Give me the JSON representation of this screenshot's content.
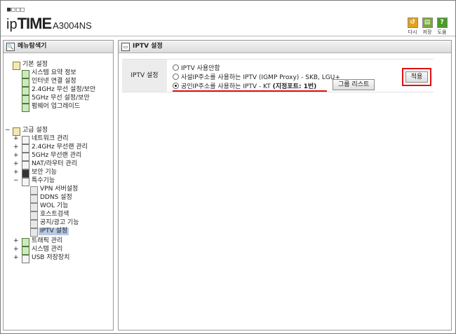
{
  "header": {
    "logo_dots": "■□□□",
    "brand_ip": "ip",
    "brand_time": "TIME",
    "model": "A3004NS",
    "buttons": [
      {
        "label": "다시",
        "icon": "refresh-icon",
        "color": "#e3a21a"
      },
      {
        "label": "저장",
        "icon": "save-icon",
        "color": "#7aa83a"
      },
      {
        "label": "도움",
        "icon": "help-icon",
        "color": "#4a9a2a"
      }
    ]
  },
  "sidebar": {
    "title": "메뉴탐색기",
    "basic": {
      "label": "기본 설정",
      "items": [
        "시스템 요약 정보",
        "인터넷 연결 설정",
        "2.4GHz 무선 설정/보안",
        "5GHz 무선 설정/보안",
        "펌웨어 업그레이드"
      ]
    },
    "advanced": {
      "label": "고급 설정",
      "items": [
        "네트워크 관리",
        "2.4GHz 무선랜 관리",
        "5GHz 무선랜 관리",
        "NAT/라우터 관리",
        "보안 기능",
        "특수기능"
      ],
      "special_items": [
        "VPN 서버설정",
        "DDNS 설정",
        "WOL 기능",
        "호스트검색",
        "공지/광고 기능",
        "IPTV 설정"
      ],
      "tail_items": [
        "트래픽 관리",
        "시스템 관리",
        "USB 저장장치"
      ]
    }
  },
  "main": {
    "title": "IPTV 설정",
    "row_label": "IPTV 설정",
    "options": [
      {
        "label": "IPTV 사용안함",
        "selected": false
      },
      {
        "label": "사설IP주소를 사용하는 IPTV (IGMP Proxy) - SKB, LGU+",
        "selected": false
      },
      {
        "label": "공인IP주소를 사용하는 IPTV - KT",
        "bold": "(지정포트: 1번)",
        "selected": true
      }
    ],
    "group_button": "그룹 리스트",
    "apply_button": "적용"
  }
}
